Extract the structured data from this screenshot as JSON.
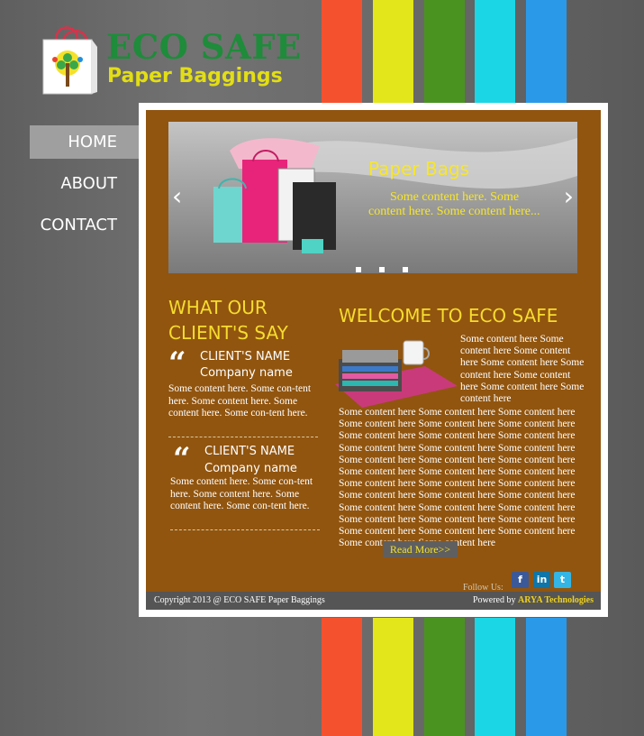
{
  "logo": {
    "title": "ECO SAFE",
    "subtitle": "Paper Baggings"
  },
  "nav": [
    {
      "label": "HOME",
      "active": true
    },
    {
      "label": "ABOUT"
    },
    {
      "label": "CONTACT"
    }
  ],
  "slider": {
    "title": "Paper Bags",
    "text": "Some content here. Some content here. Some content here...",
    "prev_icon": "chevron-left-icon",
    "next_icon": "chevron-right-icon",
    "dots_count": 3
  },
  "clients": {
    "heading": "WHAT OUR CLIENT'S SAY",
    "items": [
      {
        "name": "CLIENT'S NAME",
        "company": "Company name",
        "text": "Some content here. Some con-tent here. Some content here. Some content here. Some con-tent here."
      },
      {
        "name": "CLIENT'S NAME",
        "company": "Company name",
        "text": "Some content here. Some con-tent here. Some content here. Some content here. Some con-tent here."
      }
    ]
  },
  "welcome": {
    "heading": "WELCOME TO ECO SAFE",
    "side_text": "Some content here  Some content here Some content here Some content here Some content here Some content here Some content here Some content here",
    "main_text": "Some content here Some content here Some content here Some content here Some content here Some content here Some content here Some content here Some content here Some content here Some content here Some content here Some content here Some content here Some content here Some content here Some content here Some content here Some content here Some content here Some content here Some content here Some content here Some content here Some content here Some content here Some content here Some content here Some content here Some content here Some content here Some content here Some content here Some content here Some content here",
    "read_more": "Read More>>"
  },
  "follow": {
    "label": "Follow Us:",
    "networks": [
      {
        "name": "facebook",
        "glyph": "f",
        "color": "#3b5998"
      },
      {
        "name": "linkedin",
        "glyph": "in",
        "color": "#0e76a8"
      },
      {
        "name": "twitter",
        "glyph": "t",
        "color": "#33b5e5"
      }
    ]
  },
  "footer": {
    "copyright": "Copyright  2013 @ ECO SAFE Paper Baggings",
    "powered_prefix": "Powered by ",
    "powered_link": "ARYA Technologies"
  },
  "colors": {
    "red": "#f4522e",
    "yellow": "#e2e61a",
    "green": "#4a9321",
    "cyan": "#1bd6e4",
    "blue": "#2a9ae8",
    "panel": "#91550f",
    "accent": "#f6dc2e"
  }
}
